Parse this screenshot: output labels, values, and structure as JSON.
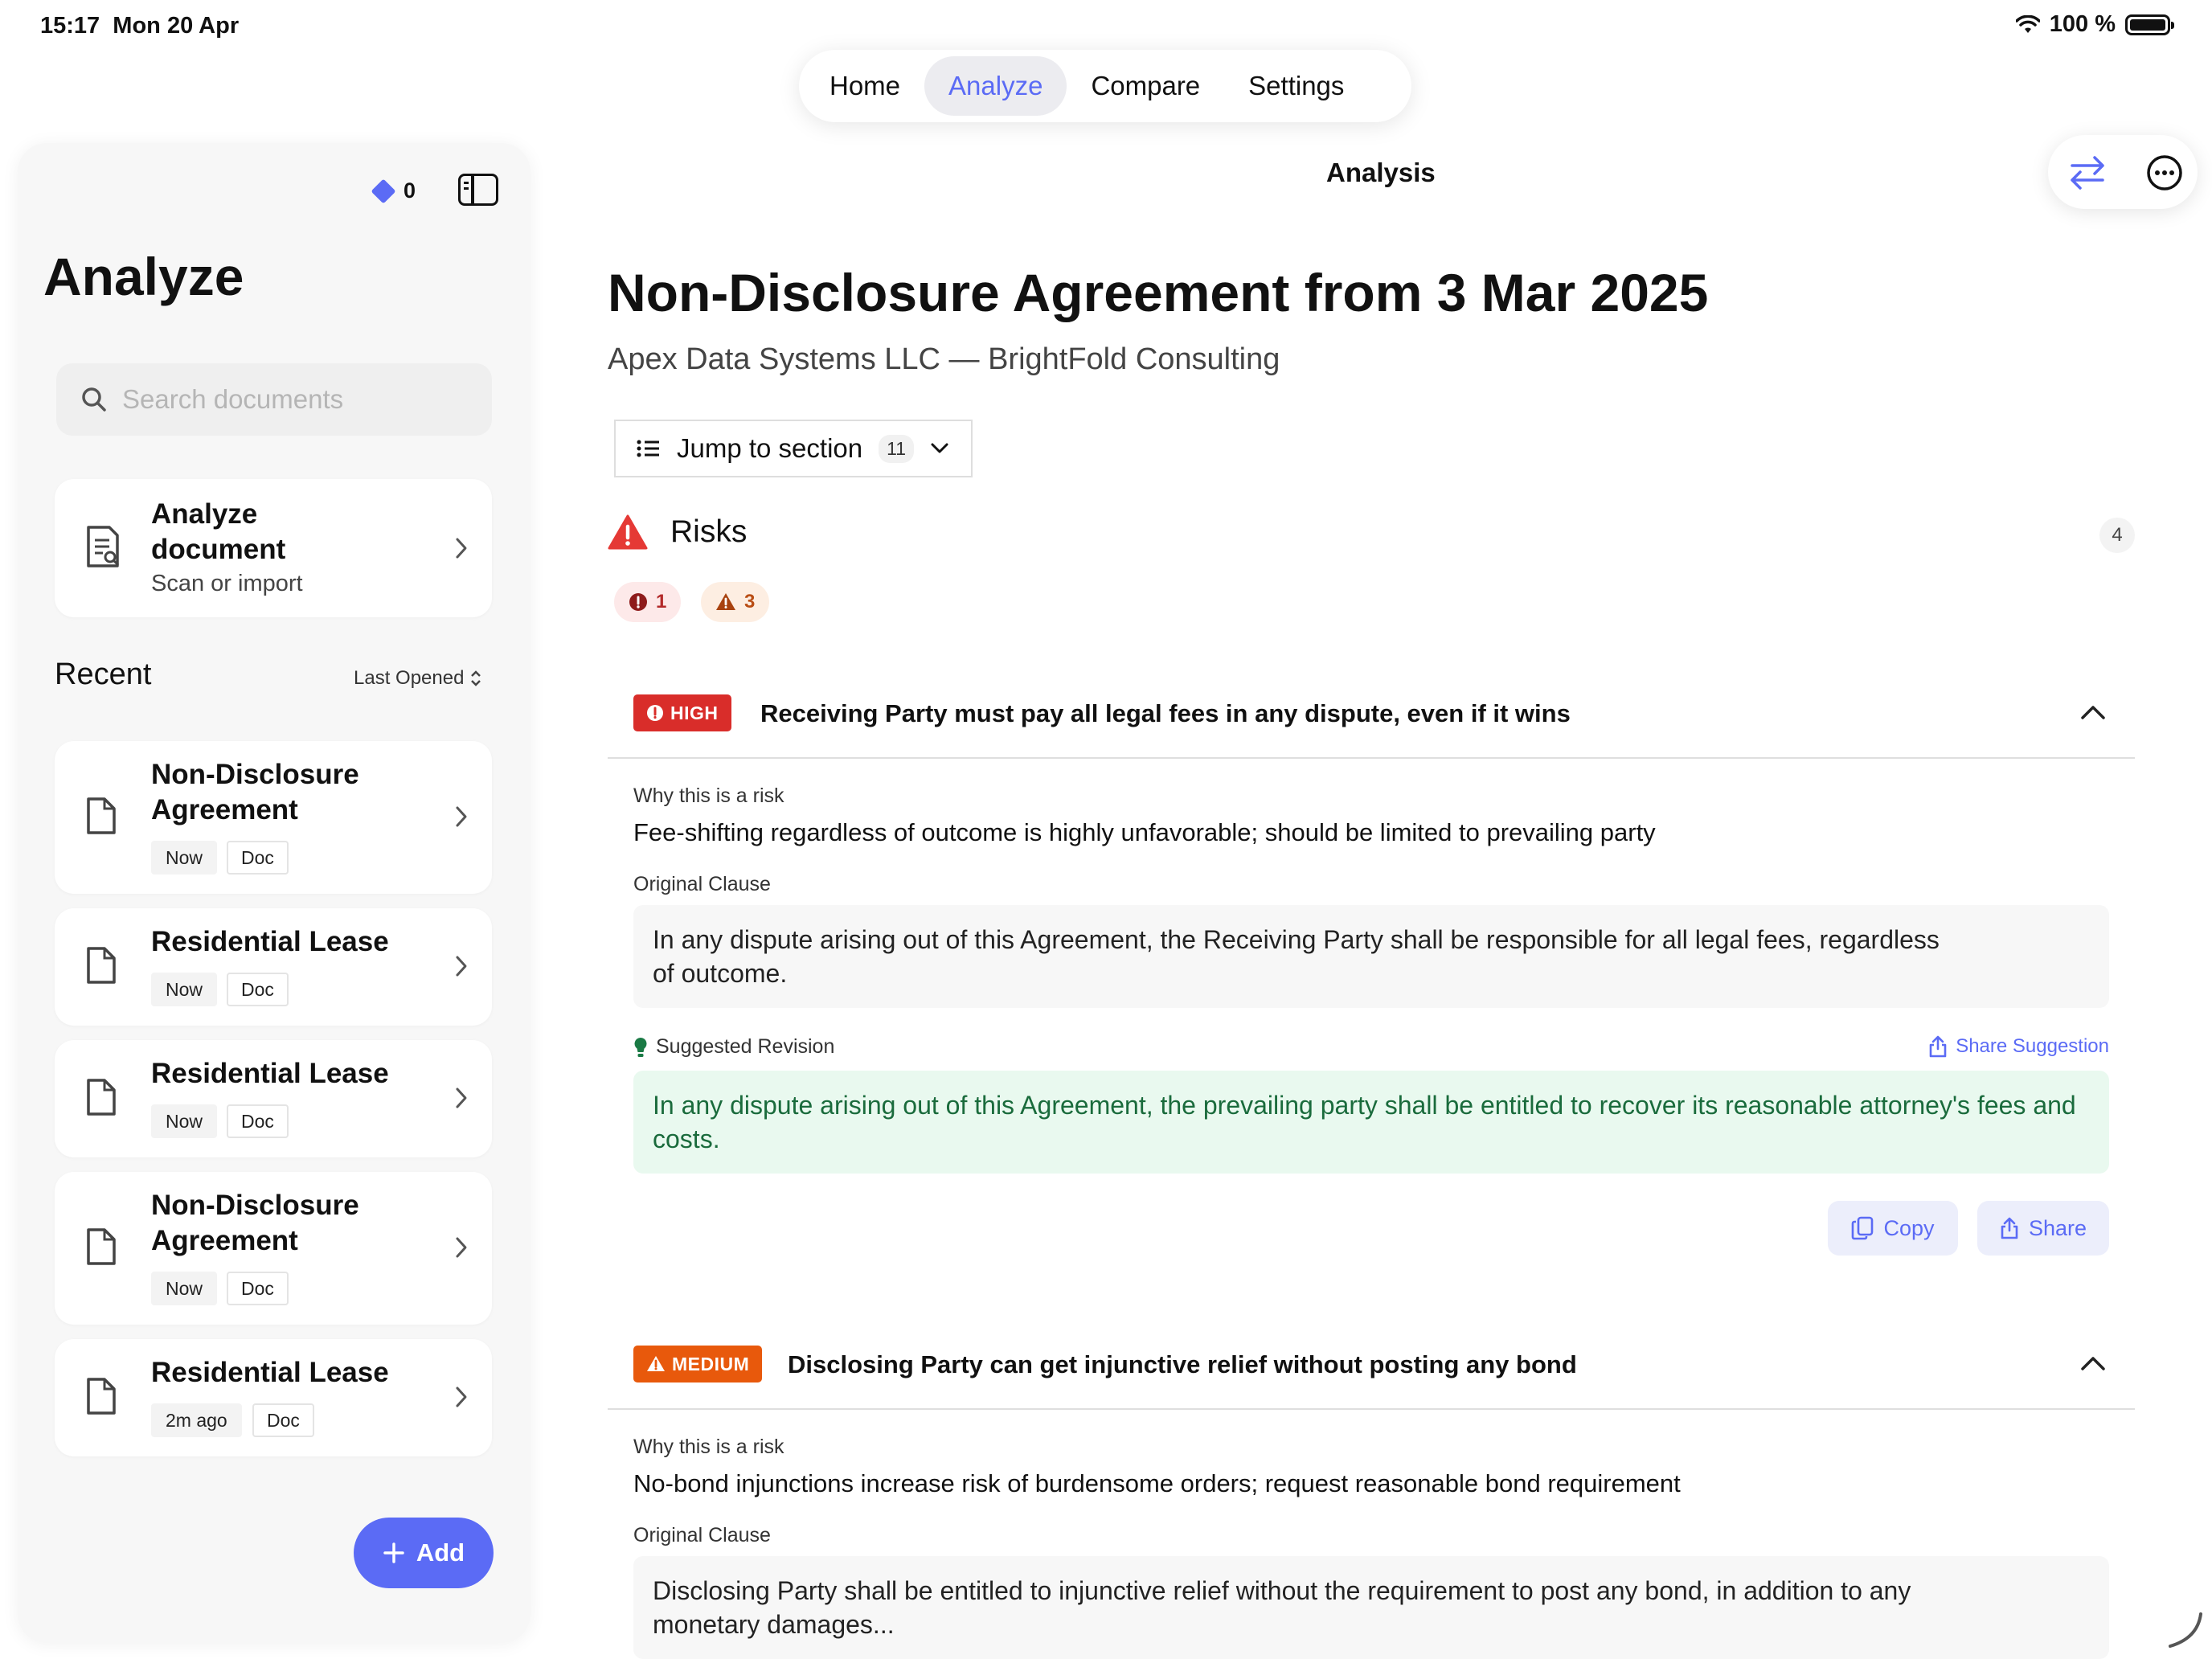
{
  "status": {
    "time": "15:17",
    "date": "Mon 20 Apr",
    "battery": "100 %"
  },
  "top_tabs": [
    {
      "label": "Home"
    },
    {
      "label": "Analyze",
      "active": true
    },
    {
      "label": "Compare"
    },
    {
      "label": "Settings"
    }
  ],
  "sidebar": {
    "badge_count": "0",
    "title": "Analyze",
    "search_placeholder": "Search documents",
    "analyze_card": {
      "title": "Analyze document",
      "title_line1": "Analyze",
      "title_line2": "document",
      "subtitle": "Scan or import"
    },
    "recent_label": "Recent",
    "sort_label": "Last Opened",
    "recent": [
      {
        "title_line1": "Non-Disclosure",
        "title_line2": "Agreement",
        "time": "Now",
        "type": "Doc"
      },
      {
        "title_line1": "Residential Lease",
        "title_line2": "",
        "time": "Now",
        "type": "Doc"
      },
      {
        "title_line1": "Residential Lease",
        "title_line2": "",
        "time": "Now",
        "type": "Doc"
      },
      {
        "title_line1": "Non-Disclosure",
        "title_line2": "Agreement",
        "time": "Now",
        "type": "Doc"
      },
      {
        "title_line1": "Residential Lease",
        "title_line2": "",
        "time": "2m ago",
        "type": "Doc"
      }
    ],
    "add_label": "Add"
  },
  "main": {
    "header_title": "Analysis",
    "doc_title": "Non-Disclosure Agreement from 3 Mar 2025",
    "doc_parties": "Apex Data Systems LLC — BrightFold Consulting",
    "jump_label": "Jump to section",
    "jump_count": "11",
    "risks_label": "Risks",
    "risks_count": "4",
    "high_count": "1",
    "medium_count": "3",
    "risks": [
      {
        "severity": "HIGH",
        "title": "Receiving Party must pay all legal fees in any dispute, even if it wins",
        "why_label": "Why this is a risk",
        "why": "Fee-shifting regardless of outcome is highly unfavorable; should be limited to prevailing party",
        "clause_label": "Original Clause",
        "clause": "In any dispute arising out of this Agreement, the Receiving Party shall be responsible for all legal fees, regardless of outcome.",
        "suggest_label": "Suggested Revision",
        "share_suggestion": "Share Suggestion",
        "suggestion": "In any dispute arising out of this Agreement, the prevailing party shall be entitled to recover its reasonable attorney's fees and costs.",
        "copy_label": "Copy",
        "share_label": "Share"
      },
      {
        "severity": "MEDIUM",
        "title": "Disclosing Party can get injunctive relief without posting any bond",
        "why_label": "Why this is a risk",
        "why": "No-bond injunctions increase risk of burdensome orders; request reasonable bond requirement",
        "clause_label": "Original Clause",
        "clause": "Disclosing Party shall be entitled to injunctive relief without the requirement to post any bond, in addition to any monetary damages..."
      }
    ]
  },
  "colors": {
    "accent": "#5b6bf5",
    "high": "#d92d2a",
    "medium": "#e8590c",
    "suggestion_bg": "#e9f9ef",
    "suggestion_text": "#1a6b3c"
  }
}
